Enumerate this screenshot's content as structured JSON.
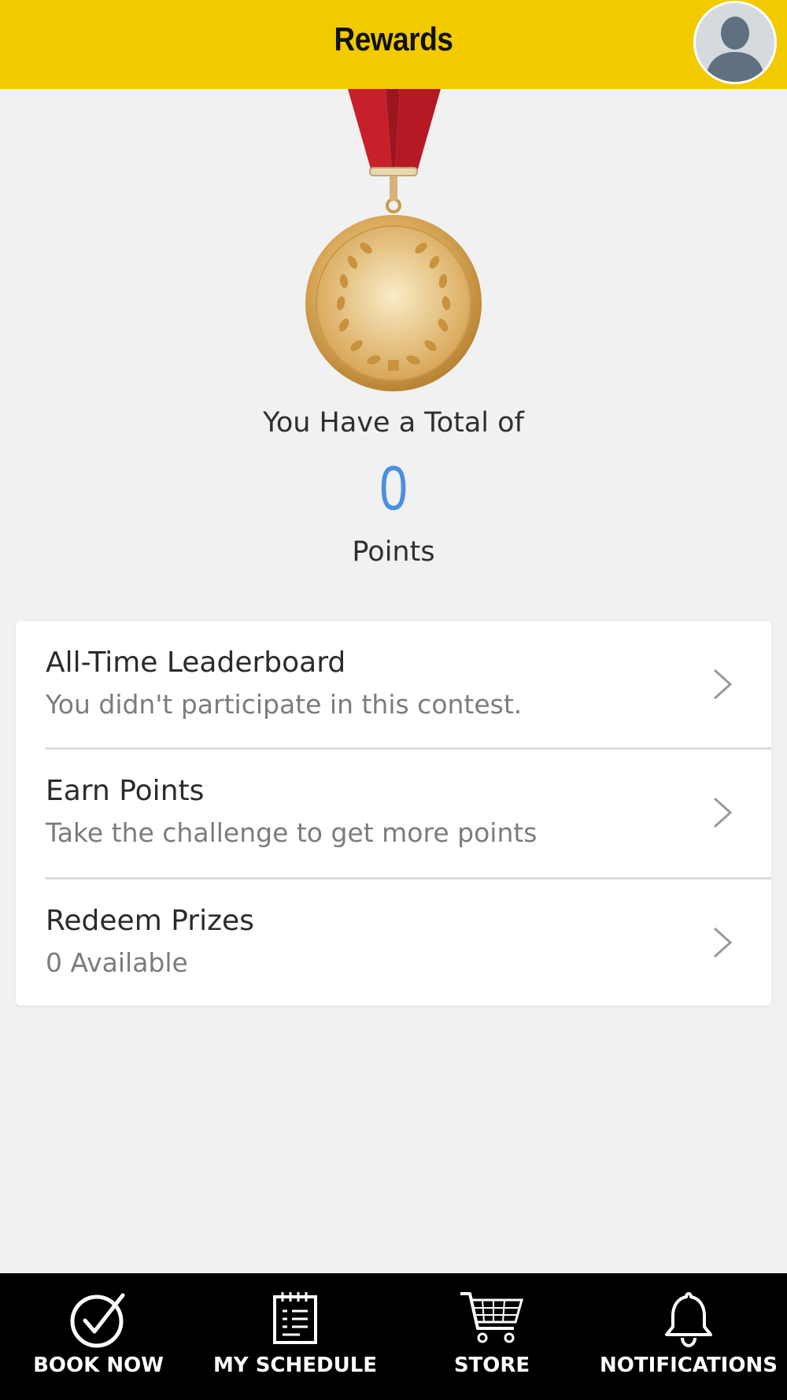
{
  "header": {
    "title": "Rewards",
    "bg_color": "#f2ca00",
    "avatar_icon": "user-avatar-icon"
  },
  "summary": {
    "total_label": "You Have a Total of",
    "points_value": "0",
    "points_unit": "Points",
    "accent_color": "#4a8fe0",
    "medal_icon": "gold-medal-icon"
  },
  "menu": {
    "items": [
      {
        "title": "All-Time Leaderboard",
        "subtitle": "You didn't participate in this contest."
      },
      {
        "title": "Earn Points",
        "subtitle": "Take the challenge to get more points"
      },
      {
        "title": "Redeem Prizes",
        "subtitle": "0 Available"
      }
    ]
  },
  "bottom_nav": {
    "items": [
      {
        "label": "BOOK NOW",
        "icon": "check-circle-icon"
      },
      {
        "label": "MY SCHEDULE",
        "icon": "calendar-icon"
      },
      {
        "label": "STORE",
        "icon": "cart-icon"
      },
      {
        "label": "NOTIFICATIONS",
        "icon": "bell-icon"
      }
    ]
  }
}
